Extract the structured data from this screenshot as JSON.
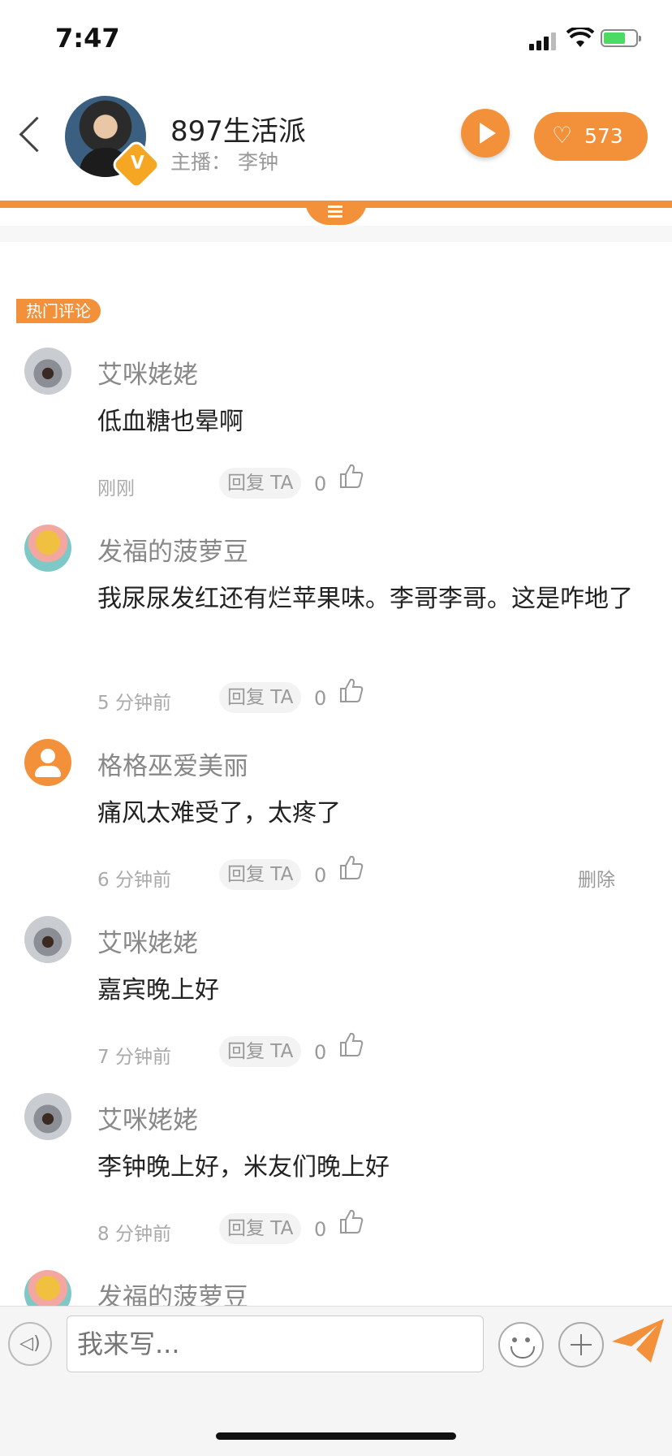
{
  "status_bar": {
    "time": "7:47"
  },
  "header": {
    "station_name": "897生活派",
    "host_line": "主播：  李钟",
    "verified_badge": "V",
    "like_count": "573"
  },
  "hot_comments_label": "热门评论",
  "comments": [
    {
      "user": "艾咪姥姥",
      "text": "低血糖也晕啊",
      "time": "刚刚",
      "reply": "回复 TA",
      "likes": "0"
    },
    {
      "user": "发福的菠萝豆",
      "text": "我尿尿发红还有烂苹果味。李哥李哥。这是咋地了",
      "time": "5 分钟前",
      "reply": "回复 TA",
      "likes": "0"
    },
    {
      "user": "格格巫爱美丽",
      "text": "痛风太难受了，太疼了",
      "time": "6 分钟前",
      "reply": "回复 TA",
      "likes": "0",
      "delete": "删除"
    },
    {
      "user": "艾咪姥姥",
      "text": "嘉宾晚上好",
      "time": "7 分钟前",
      "reply": "回复 TA",
      "likes": "0"
    },
    {
      "user": "艾咪姥姥",
      "text": "李钟晚上好，米友们晚上好",
      "time": "8 分钟前",
      "reply": "回复 TA",
      "likes": "0"
    },
    {
      "user": "发福的菠萝豆"
    }
  ],
  "input": {
    "placeholder": "我来写..."
  },
  "colors": {
    "accent": "#f3903a",
    "muted_text": "#999999",
    "body_text": "#222222"
  }
}
